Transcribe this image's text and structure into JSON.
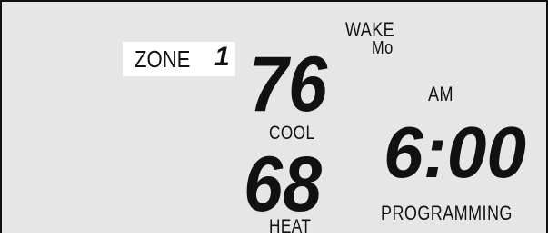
{
  "zone": {
    "label": "ZONE",
    "number": "1"
  },
  "program": {
    "period": "WAKE",
    "day": "Mo"
  },
  "cool": {
    "setpoint": "76",
    "label": "COOL"
  },
  "heat": {
    "setpoint": "68",
    "label": "HEAT"
  },
  "clock": {
    "ampm": "AM",
    "time": "6:00"
  },
  "mode": {
    "label": "PROGRAMMING"
  },
  "colors": {
    "lcd_background": "#e6e6e6",
    "segment": "#111111",
    "zone_highlight": "#ffffff"
  }
}
